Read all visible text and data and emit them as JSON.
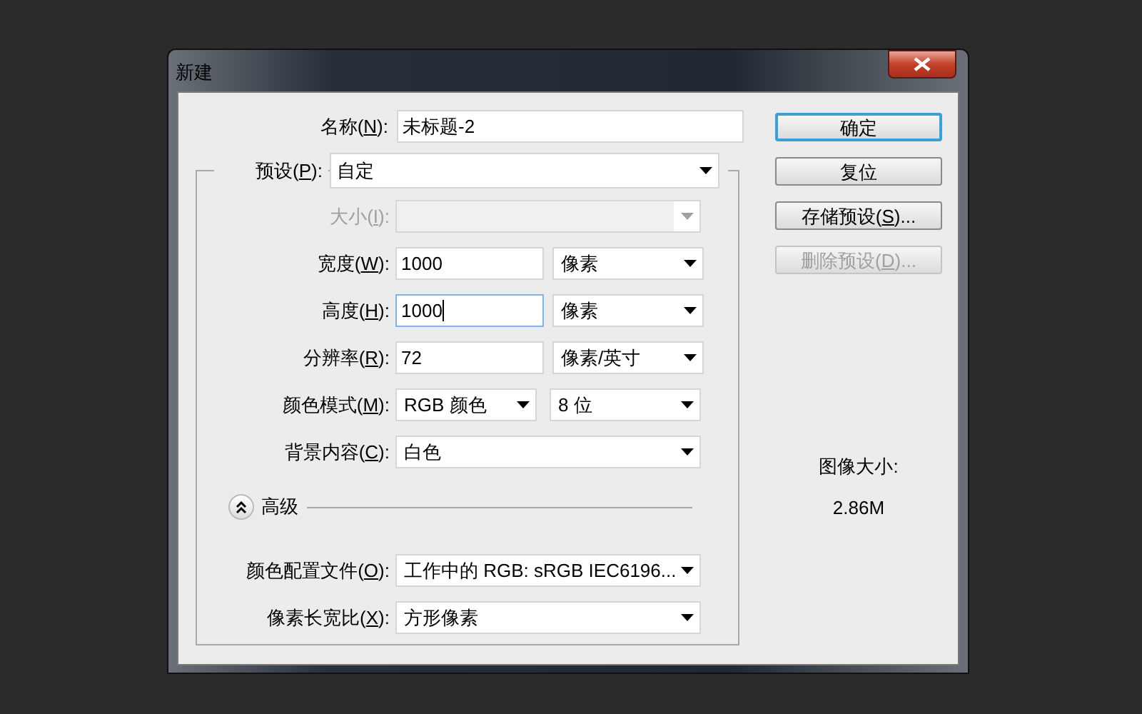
{
  "window": {
    "title": "新建"
  },
  "name_field": {
    "label": "名称(",
    "mnemonic": "N",
    "label_end": "):",
    "value": "未标题-2"
  },
  "preset": {
    "label": "预设(",
    "mnemonic": "P",
    "label_end": "):",
    "value": "自定"
  },
  "rows": [
    {
      "label": "大小(",
      "mnemonic": "I",
      "label_end": "):",
      "disabled": true,
      "controls": [
        {
          "kind": "select"
        }
      ]
    },
    {
      "label": "宽度(",
      "mnemonic": "W",
      "label_end": "):",
      "disabled": false,
      "controls": [
        {
          "kind": "text",
          "value": "1000",
          "focused": false
        },
        {
          "kind": "select",
          "value": "像素"
        }
      ]
    },
    {
      "label": "高度(",
      "mnemonic": "H",
      "label_end": "):",
      "disabled": false,
      "controls": [
        {
          "kind": "text",
          "value": "1000",
          "focused": true
        },
        {
          "kind": "select",
          "value": "像素"
        }
      ]
    },
    {
      "label": "分辨率(",
      "mnemonic": "R",
      "label_end": "):",
      "disabled": false,
      "controls": [
        {
          "kind": "text",
          "value": "72",
          "focused": false
        },
        {
          "kind": "select",
          "value": "像素/英寸"
        }
      ]
    },
    {
      "label": "颜色模式(",
      "mnemonic": "M",
      "label_end": "):",
      "disabled": false,
      "controls": [
        {
          "kind": "select",
          "value": "RGB 颜色"
        },
        {
          "kind": "select",
          "value": "8 位"
        }
      ]
    },
    {
      "label": "背景内容(",
      "mnemonic": "C",
      "label_end": "):",
      "disabled": false,
      "controls": [
        {
          "kind": "select",
          "value": "白色"
        }
      ]
    }
  ],
  "advanced": {
    "label": "高级",
    "expanded": true
  },
  "advanced_rows": [
    {
      "label": "颜色配置文件(",
      "mnemonic": "O",
      "label_end": "):",
      "disabled": false,
      "controls": [
        {
          "kind": "select",
          "value": "工作中的 RGB: sRGB IEC6196..."
        }
      ]
    },
    {
      "label": "像素长宽比(",
      "mnemonic": "X",
      "label_end": "):",
      "disabled": false,
      "controls": [
        {
          "kind": "select",
          "value": "方形像素"
        }
      ]
    }
  ],
  "buttons": [
    {
      "label": "确定",
      "default": true,
      "disabled": false
    },
    {
      "label": "复位",
      "default": false,
      "disabled": false
    },
    {
      "label": "存储预设(",
      "mnemonic": "S",
      "label_end": ")...",
      "default": false,
      "disabled": false
    },
    {
      "label": "删除预设(",
      "mnemonic": "D",
      "label_end": ")...",
      "default": false,
      "disabled": true
    }
  ],
  "image_size": {
    "label": "图像大小:",
    "value": "2.86M"
  }
}
